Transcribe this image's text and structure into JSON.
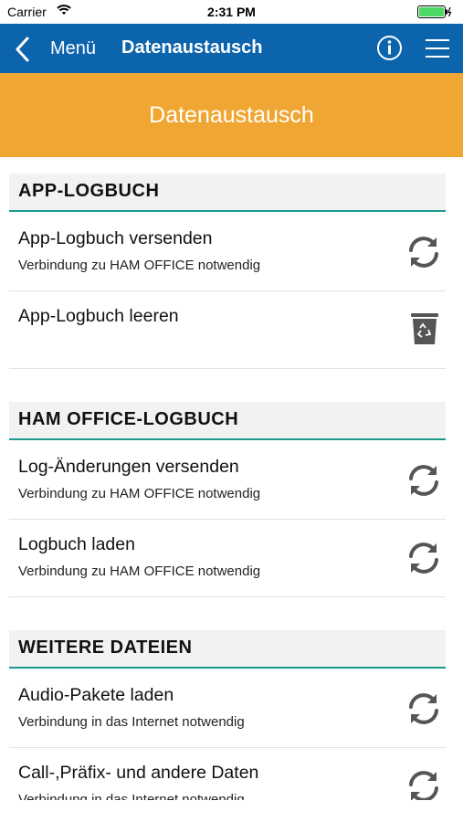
{
  "status_bar": {
    "carrier": "Carrier",
    "time": "2:31 PM"
  },
  "nav": {
    "back_label": "Menü",
    "title": "Datenaustausch",
    "info_icon": "info-icon",
    "menu_icon": "hamburger-menu-icon",
    "color": "#0c64ad"
  },
  "banner": {
    "title": "Datenaustausch",
    "color": "#f0a632"
  },
  "sections": [
    {
      "title": "APP-LOGBUCH",
      "items": [
        {
          "title": "App-Logbuch versenden",
          "subtitle": "Verbindung zu HAM OFFICE notwendig",
          "icon": "refresh-icon"
        },
        {
          "title": "App-Logbuch leeren",
          "subtitle": "",
          "icon": "trash-icon"
        }
      ]
    },
    {
      "title": "HAM OFFICE-LOGBUCH",
      "items": [
        {
          "title": "Log-Änderungen versenden",
          "subtitle": "Verbindung zu HAM OFFICE notwendig",
          "icon": "refresh-icon"
        },
        {
          "title": "Logbuch laden",
          "subtitle": "Verbindung zu HAM OFFICE notwendig",
          "icon": "refresh-icon"
        }
      ]
    },
    {
      "title": "WEITERE DATEIEN",
      "items": [
        {
          "title": "Audio-Pakete laden",
          "subtitle": "Verbindung in das Internet notwendig",
          "icon": "refresh-icon"
        },
        {
          "title": "Call-,Präfix- und andere Daten",
          "subtitle": "Verbindung in das Internet notwendig",
          "icon": "refresh-icon"
        }
      ]
    }
  ],
  "accent_color": "#1a9a8c"
}
